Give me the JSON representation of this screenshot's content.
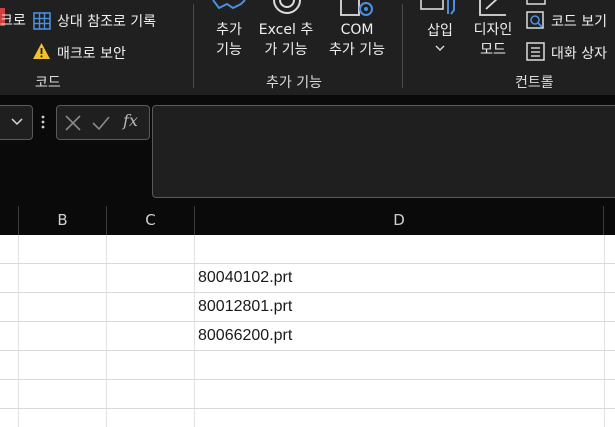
{
  "ribbon": {
    "code_group": {
      "macro_partial": "크로",
      "relative_ref": "상대 참조로 기록",
      "macro_security": "매크로 보안",
      "group_label": "코드"
    },
    "addins_group": {
      "addins_l1": "추가",
      "addins_l2": "기능",
      "excel_addins_l1": "Excel 추",
      "excel_addins_l2": "가 기능",
      "com_addins_l1": "COM",
      "com_addins_l2": "추가 기능",
      "group_label": "추가 기능"
    },
    "controls_group": {
      "insert": "삽입",
      "design_mode_l1": "디자인",
      "design_mode_l2": "모드",
      "view_code": "코드 보기",
      "dialog": "대화 상자",
      "group_label": "컨트롤"
    }
  },
  "formula_bar": {
    "fx": "fx",
    "value": ""
  },
  "columns": [
    "B",
    "C",
    "D"
  ],
  "cells": [
    {
      "ref": "D2",
      "value": "80040102.prt"
    },
    {
      "ref": "D3",
      "value": "80012801.prt"
    },
    {
      "ref": "D4",
      "value": "80066200.prt"
    }
  ],
  "colors": {
    "ribbon_bg": "#202020",
    "accent_blue": "#4a8fe0",
    "warning_yellow": "#f2c12e",
    "macro_red": "#d23f3f"
  }
}
